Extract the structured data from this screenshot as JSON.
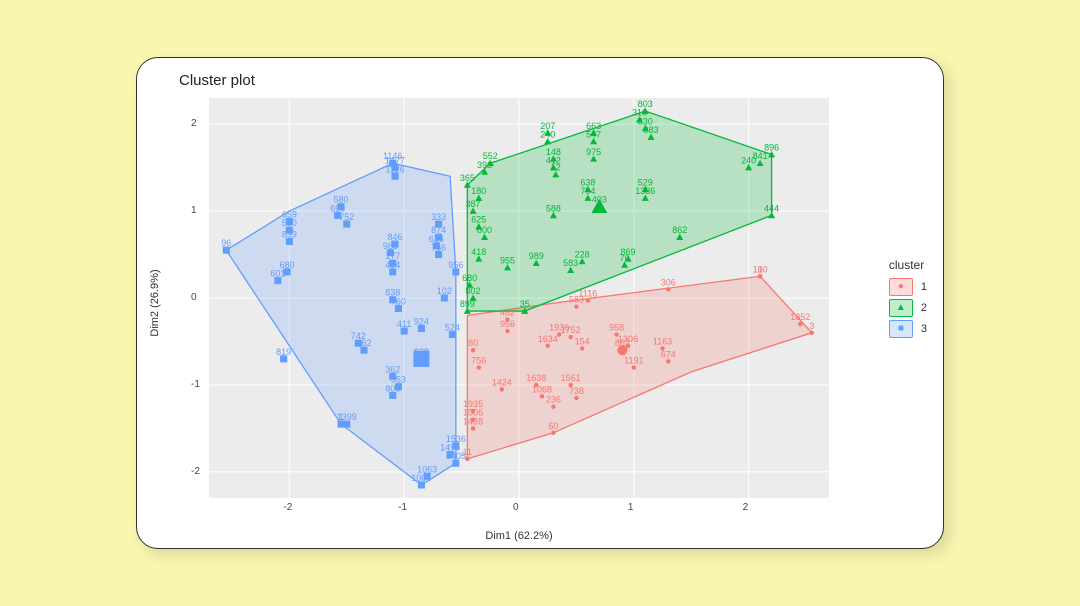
{
  "title": "Cluster plot",
  "xlabel": "Dim1 (62.2%)",
  "ylabel": "Dim2 (26.9%)",
  "legend": {
    "title": "cluster",
    "items": [
      {
        "label": "1",
        "color": "#f8766d",
        "shape": "circle"
      },
      {
        "label": "2",
        "color": "#00ba38",
        "shape": "triangle"
      },
      {
        "label": "3",
        "color": "#619cff",
        "shape": "square"
      }
    ]
  },
  "xticks": [
    "-2",
    "-1",
    "0",
    "1",
    "2"
  ],
  "yticks": [
    "-2",
    "-1",
    "0",
    "1",
    "2"
  ],
  "chart_data": {
    "type": "scatter",
    "title": "Cluster plot",
    "xlabel": "Dim1 (62.2%)",
    "ylabel": "Dim2 (26.9%)",
    "xlim": [
      -2.7,
      2.7
    ],
    "ylim": [
      -2.3,
      2.3
    ],
    "grid": true,
    "legend_position": "right",
    "clusters": [
      {
        "id": 1,
        "color": "#f8766d",
        "shape": "circle",
        "centroid": {
          "label": "862",
          "x": 0.9,
          "y": -0.6
        },
        "hull": [
          {
            "x": -0.45,
            "y": -1.85
          },
          {
            "x": -0.45,
            "y": -0.2
          },
          {
            "x": 0.35,
            "y": -0.05
          },
          {
            "x": 2.1,
            "y": 0.25
          },
          {
            "x": 2.55,
            "y": -0.4
          },
          {
            "x": 1.5,
            "y": -0.85
          },
          {
            "x": 0.3,
            "y": -1.55
          }
        ],
        "points": [
          {
            "label": "482",
            "x": -0.1,
            "y": -0.25
          },
          {
            "label": "956",
            "x": -0.1,
            "y": -0.38
          },
          {
            "label": "80",
            "x": -0.4,
            "y": -0.6
          },
          {
            "label": "756",
            "x": -0.35,
            "y": -0.8
          },
          {
            "label": "1424",
            "x": -0.15,
            "y": -1.05
          },
          {
            "label": "1935",
            "x": -0.4,
            "y": -1.3
          },
          {
            "label": "1506",
            "x": -0.4,
            "y": -1.4
          },
          {
            "label": "1438",
            "x": -0.4,
            "y": -1.5
          },
          {
            "label": "11",
            "x": -0.45,
            "y": -1.85
          },
          {
            "label": "60",
            "x": 0.3,
            "y": -1.55
          },
          {
            "label": "1638",
            "x": 0.15,
            "y": -1.0
          },
          {
            "label": "1068",
            "x": 0.2,
            "y": -1.13
          },
          {
            "label": "236",
            "x": 0.3,
            "y": -1.25
          },
          {
            "label": "1936",
            "x": 0.35,
            "y": -0.42
          },
          {
            "label": "1634",
            "x": 0.25,
            "y": -0.55
          },
          {
            "label": "1561",
            "x": 0.45,
            "y": -1.0
          },
          {
            "label": "738",
            "x": 0.5,
            "y": -1.15
          },
          {
            "label": "1752",
            "x": 0.45,
            "y": -0.45
          },
          {
            "label": "154",
            "x": 0.55,
            "y": -0.58
          },
          {
            "label": "306",
            "x": 1.3,
            "y": 0.1
          },
          {
            "label": "1116",
            "x": 0.6,
            "y": -0.03
          },
          {
            "label": "583",
            "x": 0.5,
            "y": -0.1
          },
          {
            "label": "958",
            "x": 0.85,
            "y": -0.42
          },
          {
            "label": "1306",
            "x": 0.95,
            "y": -0.55
          },
          {
            "label": "1191",
            "x": 1.0,
            "y": -0.8
          },
          {
            "label": "1163",
            "x": 1.25,
            "y": -0.58
          },
          {
            "label": "674",
            "x": 1.3,
            "y": -0.73
          },
          {
            "label": "100",
            "x": 2.1,
            "y": 0.25
          },
          {
            "label": "1",
            "x": 2.1,
            "y": 0.25
          },
          {
            "label": "1852",
            "x": 2.45,
            "y": -0.3
          },
          {
            "label": "3",
            "x": 2.55,
            "y": -0.4
          }
        ]
      },
      {
        "id": 2,
        "color": "#00ba38",
        "shape": "triangle",
        "centroid": {
          "label": "403",
          "x": 0.7,
          "y": 1.05
        },
        "hull": [
          {
            "x": -0.45,
            "y": -0.15
          },
          {
            "x": -0.45,
            "y": 1.3
          },
          {
            "x": -0.25,
            "y": 1.55
          },
          {
            "x": 1.1,
            "y": 2.15
          },
          {
            "x": 2.2,
            "y": 1.65
          },
          {
            "x": 2.2,
            "y": 0.95
          },
          {
            "x": 0.05,
            "y": -0.15
          }
        ],
        "points": [
          {
            "label": "955",
            "x": -0.1,
            "y": 0.35
          },
          {
            "label": "588",
            "x": 0.3,
            "y": 0.95
          },
          {
            "label": "899",
            "x": -0.45,
            "y": -0.15
          },
          {
            "label": "802",
            "x": -0.4,
            "y": 0.0
          },
          {
            "label": "680",
            "x": -0.43,
            "y": 0.15
          },
          {
            "label": "418",
            "x": -0.35,
            "y": 0.45
          },
          {
            "label": "800",
            "x": -0.3,
            "y": 0.7
          },
          {
            "label": "625",
            "x": -0.35,
            "y": 0.82
          },
          {
            "label": "387",
            "x": -0.4,
            "y": 1.0
          },
          {
            "label": "180",
            "x": -0.35,
            "y": 1.15
          },
          {
            "label": "365",
            "x": -0.45,
            "y": 1.3
          },
          {
            "label": "396",
            "x": -0.3,
            "y": 1.45
          },
          {
            "label": "552",
            "x": -0.25,
            "y": 1.55
          },
          {
            "label": "35",
            "x": 0.05,
            "y": -0.15
          },
          {
            "label": "989",
            "x": 0.15,
            "y": 0.4
          },
          {
            "label": "412",
            "x": 0.3,
            "y": 1.5
          },
          {
            "label": "148",
            "x": 0.3,
            "y": 1.6
          },
          {
            "label": "12",
            "x": 0.32,
            "y": 1.42
          },
          {
            "label": "240",
            "x": 0.25,
            "y": 1.8
          },
          {
            "label": "207",
            "x": 0.25,
            "y": 1.9
          },
          {
            "label": "228",
            "x": 0.55,
            "y": 0.42
          },
          {
            "label": "583",
            "x": 0.45,
            "y": 0.32
          },
          {
            "label": "794",
            "x": 0.6,
            "y": 1.15
          },
          {
            "label": "638",
            "x": 0.6,
            "y": 1.25
          },
          {
            "label": "975",
            "x": 0.65,
            "y": 1.6
          },
          {
            "label": "547",
            "x": 0.65,
            "y": 1.8
          },
          {
            "label": "663",
            "x": 0.65,
            "y": 1.9
          },
          {
            "label": "869",
            "x": 0.95,
            "y": 0.45
          },
          {
            "label": "70",
            "x": 0.92,
            "y": 0.38
          },
          {
            "label": "529",
            "x": 1.1,
            "y": 1.25
          },
          {
            "label": "1336",
            "x": 1.1,
            "y": 1.15
          },
          {
            "label": "316",
            "x": 1.05,
            "y": 2.05
          },
          {
            "label": "830",
            "x": 1.1,
            "y": 1.95
          },
          {
            "label": "983",
            "x": 1.15,
            "y": 1.85
          },
          {
            "label": "803",
            "x": 1.1,
            "y": 2.15
          },
          {
            "label": "862",
            "x": 1.4,
            "y": 0.7
          },
          {
            "label": "444",
            "x": 2.2,
            "y": 0.95
          },
          {
            "label": "240",
            "x": 2.0,
            "y": 1.5
          },
          {
            "label": "896",
            "x": 2.2,
            "y": 1.65
          },
          {
            "label": "841",
            "x": 2.1,
            "y": 1.55
          }
        ]
      },
      {
        "id": 3,
        "color": "#619cff",
        "shape": "square",
        "centroid": {
          "label": "828",
          "x": -0.85,
          "y": -0.7
        },
        "hull": [
          {
            "x": -2.55,
            "y": 0.55
          },
          {
            "x": -2.0,
            "y": 1.0
          },
          {
            "x": -1.1,
            "y": 1.55
          },
          {
            "x": -0.6,
            "y": 1.4
          },
          {
            "x": -0.55,
            "y": 0.3
          },
          {
            "x": -0.55,
            "y": -1.9
          },
          {
            "x": -0.85,
            "y": -2.15
          },
          {
            "x": -1.55,
            "y": -1.45
          }
        ],
        "points": [
          {
            "label": "828",
            "x": -0.85,
            "y": -0.7
          },
          {
            "label": "1536",
            "x": -0.55,
            "y": -1.7
          },
          {
            "label": "1496",
            "x": -0.6,
            "y": -1.8
          },
          {
            "label": "1405",
            "x": -0.55,
            "y": -1.9
          },
          {
            "label": "1004",
            "x": -0.85,
            "y": -2.15
          },
          {
            "label": "1063",
            "x": -0.8,
            "y": -2.05
          },
          {
            "label": "1399",
            "x": -1.5,
            "y": -1.45
          },
          {
            "label": "1",
            "x": -1.55,
            "y": -1.45
          },
          {
            "label": "362",
            "x": -1.1,
            "y": -0.9
          },
          {
            "label": "924",
            "x": -0.85,
            "y": -0.35
          },
          {
            "label": "411",
            "x": -1.0,
            "y": -0.38
          },
          {
            "label": "838",
            "x": -1.1,
            "y": -0.02
          },
          {
            "label": "760",
            "x": -1.05,
            "y": -0.12
          },
          {
            "label": "819",
            "x": -2.05,
            "y": -0.7
          },
          {
            "label": "962",
            "x": -1.35,
            "y": -0.6
          },
          {
            "label": "742",
            "x": -1.4,
            "y": -0.52
          },
          {
            "label": "353",
            "x": -1.05,
            "y": -1.02
          },
          {
            "label": "806",
            "x": -1.1,
            "y": -1.12
          },
          {
            "label": "601",
            "x": -2.1,
            "y": 0.2
          },
          {
            "label": "680",
            "x": -2.02,
            "y": 0.3
          },
          {
            "label": "659",
            "x": -2.0,
            "y": 0.88
          },
          {
            "label": "96",
            "x": -2.55,
            "y": 0.55
          },
          {
            "label": "530",
            "x": -2.0,
            "y": 0.78
          },
          {
            "label": "752",
            "x": -1.5,
            "y": 0.85
          },
          {
            "label": "839",
            "x": -2.0,
            "y": 0.65
          },
          {
            "label": "580",
            "x": -1.55,
            "y": 1.05
          },
          {
            "label": "699",
            "x": -1.58,
            "y": 0.95
          },
          {
            "label": "177",
            "x": -1.1,
            "y": 0.4
          },
          {
            "label": "983",
            "x": -1.12,
            "y": 0.52
          },
          {
            "label": "846",
            "x": -1.08,
            "y": 0.62
          },
          {
            "label": "454",
            "x": -1.1,
            "y": 0.3
          },
          {
            "label": "874",
            "x": -0.7,
            "y": 0.7
          },
          {
            "label": "636",
            "x": -0.72,
            "y": 0.6
          },
          {
            "label": "766",
            "x": -0.7,
            "y": 0.5
          },
          {
            "label": "333",
            "x": -0.7,
            "y": 0.85
          },
          {
            "label": "524",
            "x": -0.58,
            "y": -0.42
          },
          {
            "label": "956",
            "x": -0.55,
            "y": 0.3
          },
          {
            "label": "1126",
            "x": -1.08,
            "y": 1.4
          },
          {
            "label": "1146",
            "x": -1.1,
            "y": 1.55
          },
          {
            "label": "1477",
            "x": -1.08,
            "y": 1.5
          },
          {
            "label": "102",
            "x": -0.65,
            "y": 0.0
          }
        ]
      }
    ]
  }
}
